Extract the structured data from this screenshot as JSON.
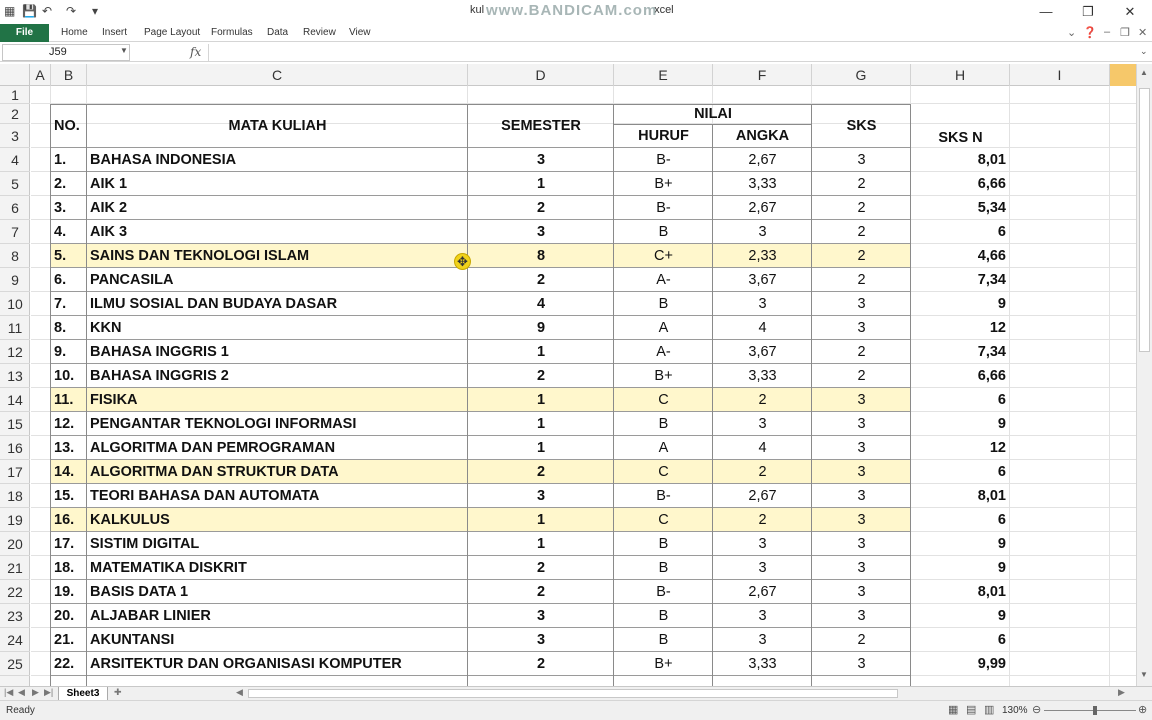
{
  "app": {
    "title": "kul",
    "title_suffix": "xcel",
    "watermark": "www.BANDICAM.com"
  },
  "ribbon": {
    "file": "File",
    "tabs": [
      "Home",
      "Insert",
      "Page Layout",
      "Formulas",
      "Data",
      "Review",
      "View"
    ]
  },
  "formula_bar": {
    "name_box": "J59",
    "fx": "fx",
    "value": ""
  },
  "columns": [
    "A",
    "B",
    "C",
    "D",
    "E",
    "F",
    "G",
    "H",
    "I"
  ],
  "rows": [
    "1",
    "2",
    "3",
    "4",
    "5",
    "6",
    "7",
    "8",
    "9",
    "10",
    "11",
    "12",
    "13",
    "14",
    "15",
    "16",
    "17",
    "18",
    "19",
    "20",
    "21",
    "22",
    "23",
    "24",
    "25"
  ],
  "headers": {
    "no": "NO.",
    "mata_kuliah": "MATA KULIAH",
    "semester": "SEMESTER",
    "nilai": "NILAI",
    "huruf": "HURUF",
    "angka": "ANGKA",
    "sks": "SKS",
    "sks_n": "SKS N"
  },
  "table": [
    {
      "no": "1.",
      "mk": "BAHASA INDONESIA",
      "sem": "3",
      "huruf": "B-",
      "angka": "2,67",
      "sks": "3",
      "sksn": "8,01",
      "hl": false
    },
    {
      "no": "2.",
      "mk": "AIK 1",
      "sem": "1",
      "huruf": "B+",
      "angka": "3,33",
      "sks": "2",
      "sksn": "6,66",
      "hl": false
    },
    {
      "no": "3.",
      "mk": "AIK 2",
      "sem": "2",
      "huruf": "B-",
      "angka": "2,67",
      "sks": "2",
      "sksn": "5,34",
      "hl": false
    },
    {
      "no": "4.",
      "mk": "AIK 3",
      "sem": "3",
      "huruf": "B",
      "angka": "3",
      "sks": "2",
      "sksn": "6",
      "hl": false
    },
    {
      "no": "5.",
      "mk": "SAINS DAN TEKNOLOGI ISLAM",
      "sem": "8",
      "huruf": "C+",
      "angka": "2,33",
      "sks": "2",
      "sksn": "4,66",
      "hl": true
    },
    {
      "no": "6.",
      "mk": "PANCASILA",
      "sem": "2",
      "huruf": "A-",
      "angka": "3,67",
      "sks": "2",
      "sksn": "7,34",
      "hl": false
    },
    {
      "no": "7.",
      "mk": "ILMU SOSIAL DAN BUDAYA DASAR",
      "sem": "4",
      "huruf": "B",
      "angka": "3",
      "sks": "3",
      "sksn": "9",
      "hl": false
    },
    {
      "no": "8.",
      "mk": "KKN",
      "sem": "9",
      "huruf": "A",
      "angka": "4",
      "sks": "3",
      "sksn": "12",
      "hl": false
    },
    {
      "no": "9.",
      "mk": "BAHASA INGGRIS 1",
      "sem": "1",
      "huruf": "A-",
      "angka": "3,67",
      "sks": "2",
      "sksn": "7,34",
      "hl": false
    },
    {
      "no": "10.",
      "mk": "BAHASA INGGRIS 2",
      "sem": "2",
      "huruf": "B+",
      "angka": "3,33",
      "sks": "2",
      "sksn": "6,66",
      "hl": false
    },
    {
      "no": "11.",
      "mk": "FISIKA",
      "sem": "1",
      "huruf": "C",
      "angka": "2",
      "sks": "3",
      "sksn": "6",
      "hl": true
    },
    {
      "no": "12.",
      "mk": "PENGANTAR TEKNOLOGI INFORMASI",
      "sem": "1",
      "huruf": "B",
      "angka": "3",
      "sks": "3",
      "sksn": "9",
      "hl": false
    },
    {
      "no": "13.",
      "mk": "ALGORITMA DAN PEMROGRAMAN",
      "sem": "1",
      "huruf": "A",
      "angka": "4",
      "sks": "3",
      "sksn": "12",
      "hl": false
    },
    {
      "no": "14.",
      "mk": "ALGORITMA DAN STRUKTUR DATA",
      "sem": "2",
      "huruf": "C",
      "angka": "2",
      "sks": "3",
      "sksn": "6",
      "hl": true
    },
    {
      "no": "15.",
      "mk": "TEORI BAHASA DAN AUTOMATA",
      "sem": "3",
      "huruf": "B-",
      "angka": "2,67",
      "sks": "3",
      "sksn": "8,01",
      "hl": false
    },
    {
      "no": "16.",
      "mk": "KALKULUS",
      "sem": "1",
      "huruf": "C",
      "angka": "2",
      "sks": "3",
      "sksn": "6",
      "hl": true
    },
    {
      "no": "17.",
      "mk": "SISTIM DIGITAL",
      "sem": "1",
      "huruf": "B",
      "angka": "3",
      "sks": "3",
      "sksn": "9",
      "hl": false
    },
    {
      "no": "18.",
      "mk": "MATEMATIKA DISKRIT",
      "sem": "2",
      "huruf": "B",
      "angka": "3",
      "sks": "3",
      "sksn": "9",
      "hl": false
    },
    {
      "no": "19.",
      "mk": "BASIS DATA 1",
      "sem": "2",
      "huruf": "B-",
      "angka": "2,67",
      "sks": "3",
      "sksn": "8,01",
      "hl": false
    },
    {
      "no": "20.",
      "mk": "ALJABAR LINIER",
      "sem": "3",
      "huruf": "B",
      "angka": "3",
      "sks": "3",
      "sksn": "9",
      "hl": false
    },
    {
      "no": "21.",
      "mk": "AKUNTANSI",
      "sem": "3",
      "huruf": "B",
      "angka": "3",
      "sks": "2",
      "sksn": "6",
      "hl": false
    },
    {
      "no": "22.",
      "mk": "ARSITEKTUR DAN ORGANISASI KOMPUTER",
      "sem": "2",
      "huruf": "B+",
      "angka": "3,33",
      "sks": "3",
      "sksn": "9,99",
      "hl": false
    }
  ],
  "sheets": [
    "Sheet3"
  ],
  "status": {
    "ready": "Ready",
    "zoom": "130%"
  },
  "colors": {
    "highlight": "#fff7cc",
    "file_tab": "#217346",
    "cursor": "#f1d21a"
  }
}
